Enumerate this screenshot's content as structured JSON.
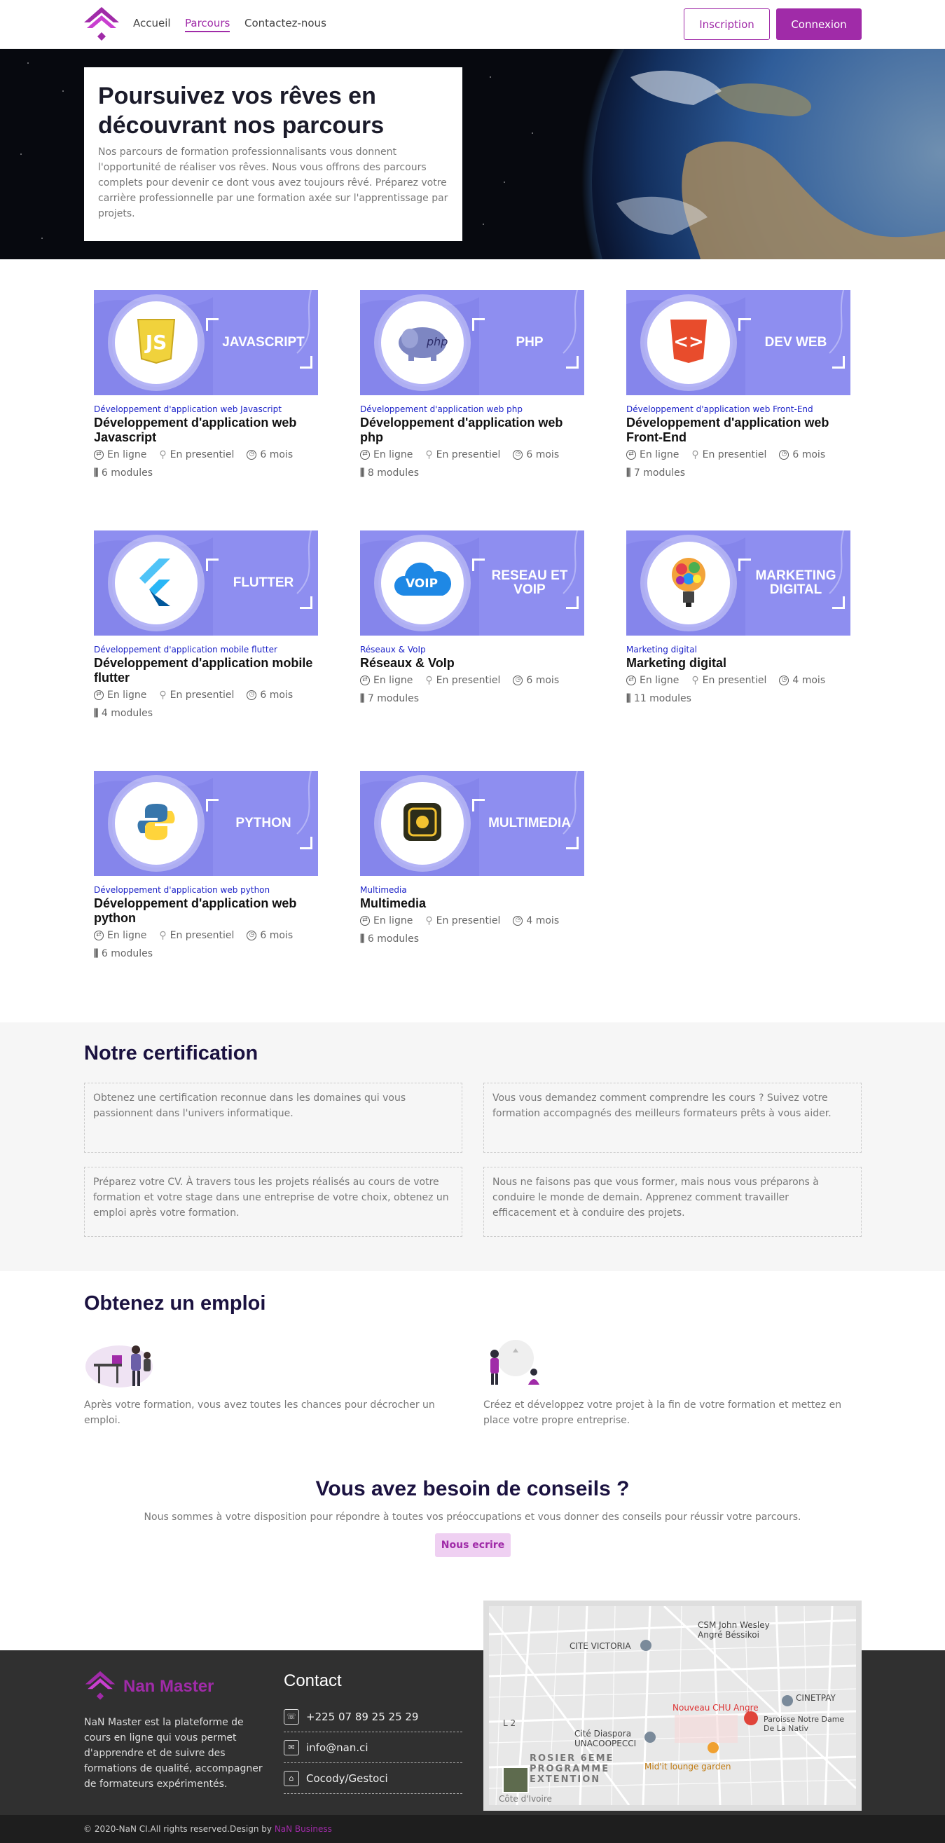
{
  "header": {
    "nav": [
      "Accueil",
      "Parcours",
      "Contactez-nous"
    ],
    "active_nav": "Parcours",
    "inscription_label": "Inscription",
    "connexion_label": "Connexion",
    "accent_color": "#a02ba8"
  },
  "hero": {
    "title": "Poursuivez vos rêves en découvrant nos parcours",
    "text": "Nos parcours de formation professionnalisants vous donnent l'opportunité de réaliser vos rêves. Nous vous offrons des parcours complets pour devenir ce dont vous avez toujours rêvé. Préparez votre carrière professionnelle par une formation axée sur l'apprentissage par projets."
  },
  "courses": [
    {
      "banner": "JAVASCRIPT",
      "icon": "javascript-icon",
      "category": "Développement d'application web Javascript",
      "title": "Développement d'application web Javascript",
      "online": "En ligne",
      "onsite": "En presentiel",
      "duration": "6 mois",
      "modules": "6 modules"
    },
    {
      "banner": "PHP",
      "icon": "php-elephant-icon",
      "category": "Développement d'application web php",
      "title": "Développement d'application web php",
      "online": "En ligne",
      "onsite": "En presentiel",
      "duration": "6 mois",
      "modules": "8 modules"
    },
    {
      "banner": "DEV WEB",
      "icon": "html5-icon",
      "category": "Développement d'application web Front-End",
      "title": "Développement d'application web Front-End",
      "online": "En ligne",
      "onsite": "En presentiel",
      "duration": "6 mois",
      "modules": "7 modules"
    },
    {
      "banner": "FLUTTER",
      "icon": "flutter-icon",
      "category": "Développement d'application mobile flutter",
      "title": "Développement d'application mobile flutter",
      "online": "En ligne",
      "onsite": "En presentiel",
      "duration": "6 mois",
      "modules": "4 modules"
    },
    {
      "banner": "RESEAU ET VOIP",
      "icon": "voip-cloud-icon",
      "category": "Réseaux & VoIp",
      "title": "Réseaux & VoIp",
      "online": "En ligne",
      "onsite": "En presentiel",
      "duration": "6 mois",
      "modules": "7 modules"
    },
    {
      "banner": "MARKETING DIGITAL",
      "icon": "lightbulb-icon",
      "category": "Marketing digital",
      "title": "Marketing digital",
      "online": "En ligne",
      "onsite": "En presentiel",
      "duration": "4 mois",
      "modules": "11 modules"
    },
    {
      "banner": "PYTHON",
      "icon": "python-icon",
      "category": "Développement d'application web python",
      "title": "Développement d'application web python",
      "online": "En ligne",
      "onsite": "En presentiel",
      "duration": "6 mois",
      "modules": "6 modules"
    },
    {
      "banner": "MULTIMEDIA",
      "icon": "multimedia-chip-icon",
      "category": "Multimedia",
      "title": "Multimedia",
      "online": "En ligne",
      "onsite": "En presentiel",
      "duration": "4 mois",
      "modules": "6 modules"
    }
  ],
  "certification": {
    "title": "Notre certification",
    "boxes": [
      "Obtenez une certification reconnue dans les domaines qui vous passionnent dans l'univers informatique.",
      "Vous vous demandez comment comprendre les cours ? Suivez votre formation accompagnés des meilleurs formateurs prêts à vous aider.",
      "Préparez votre CV. À travers tous les projets réalisés au cours de votre formation et votre stage dans une entreprise de votre choix, obtenez un emploi après votre formation.",
      "Nous ne faisons pas que vous former, mais nous vous préparons à conduire le monde de demain. Apprenez comment travailler efficacement et à conduire des projets."
    ]
  },
  "emploi": {
    "title": "Obtenez un emploi",
    "left": "Après votre formation, vous avez toutes les chances pour décrocher un emploi.",
    "right": "Créez et développez votre projet à la fin de votre formation et mettez en place votre propre entreprise."
  },
  "conseils": {
    "title": "Vous avez besoin de conseils ?",
    "text": "Nous sommes à votre disposition pour répondre à toutes vos préoccupations et vous donner des conseils pour réussir votre parcours.",
    "button": "Nous ecrire"
  },
  "footer": {
    "brand": "Nan Master",
    "about": "NaN Master est la plateforme de cours en ligne qui vous permet d'apprendre et de suivre des formations de qualité, accompagner de formateurs expérimentés.",
    "contact_title": "Contact",
    "phone": "+225 07 89 25 25 29",
    "email": "info@nan.ci",
    "address": "Cocody/Gestoci",
    "copyright": "© 2020-NaN CI.All rights reserved.Design by ",
    "designer": "NaN Business"
  },
  "map": {
    "labels": [
      "CSM John Wesley Angré Béssikoi",
      "CITE VICTORIA",
      "CINETPAY",
      "Nouveau CHU Angre",
      "Paroisse Notre Dame De La Nativ",
      "Cité Diaspora UNACOOPECCI",
      "Mid'it lounge garden",
      "ROSIER 6EME PROGRAMME EXTENTION",
      "Côte d'Ivoire",
      "L 2"
    ]
  }
}
